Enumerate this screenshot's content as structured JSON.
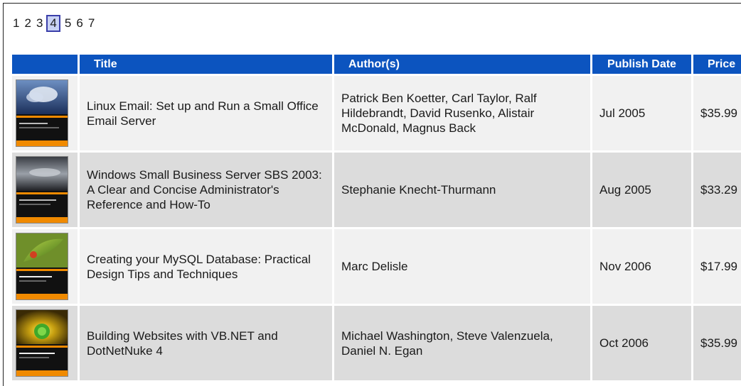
{
  "pagination": {
    "pages": [
      "1",
      "2",
      "3",
      "4",
      "5",
      "6",
      "7"
    ],
    "current": "4"
  },
  "table": {
    "headers": {
      "cover": "",
      "title": "Title",
      "authors": "Author(s)",
      "publish_date": "Publish Date",
      "price": "Price"
    },
    "rows": [
      {
        "cover_icon": "book-cover-linux-email",
        "title": "Linux Email: Set up and Run a Small Office Email Server",
        "authors": "Patrick Ben Koetter, Carl Taylor, Ralf Hildebrandt, David Rusenko, Alistair McDonald, Magnus Back",
        "publish_date": "Jul 2005",
        "price": "$35.99"
      },
      {
        "cover_icon": "book-cover-windows-sbs",
        "title": "Windows Small Business Server SBS 2003: A Clear and Concise Administrator's Reference and How-To",
        "authors": "Stephanie Knecht-Thurmann",
        "publish_date": "Aug 2005",
        "price": "$33.29"
      },
      {
        "cover_icon": "book-cover-mysql-database",
        "title": "Creating your MySQL Database: Practical Design Tips and Techniques",
        "authors": "Marc Delisle",
        "publish_date": "Nov 2006",
        "price": "$17.99"
      },
      {
        "cover_icon": "book-cover-vbnet-dotnetnuke",
        "title": "Building Websites with VB.NET and DotNetNuke 4",
        "authors": "Michael Washington, Steve Valenzuela, Daniel N. Egan",
        "publish_date": "Oct 2006",
        "price": "$35.99"
      }
    ]
  },
  "colors": {
    "header_bg": "#0c54bf",
    "row_odd": "#f1f1f1",
    "row_even": "#dcdcdc",
    "current_page_bg": "#c9d2f4",
    "current_page_border": "#3b3faa",
    "cover_accent": "#f08a00"
  }
}
